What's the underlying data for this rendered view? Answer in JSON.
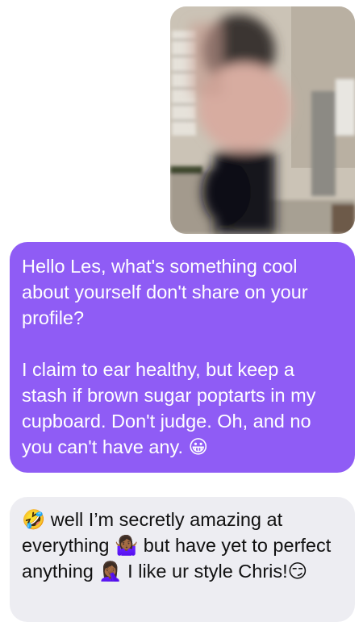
{
  "conversation": {
    "photo": {
      "icon": "blurred-photo",
      "blurred": true
    },
    "outgoing_message": {
      "paragraph_1": "Hello Les, what's something cool about yourself don't share on your profile?",
      "paragraph_2": "I claim to ear healthy, but keep a stash if brown sugar poptarts in my cupboard. Don't judge.  Oh, and no you can't have any. 😀",
      "bubble_color": "#8f5cf5",
      "text_color": "#ffffff"
    },
    "incoming_message": {
      "text": "🤣 well I’m secretly amazing at everything 🤷🏾‍♀️ but have yet to perfect anything 🤦🏾‍♀️ I like ur style Chris!😏",
      "bubble_color": "#ededf2",
      "text_color": "#111111"
    }
  }
}
